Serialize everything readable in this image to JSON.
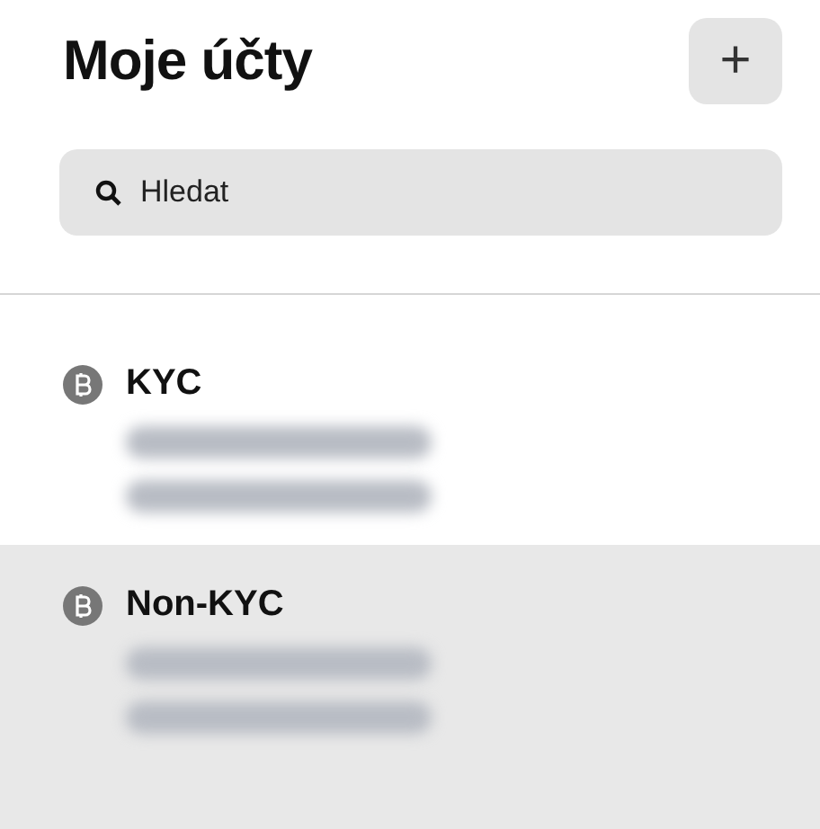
{
  "header": {
    "title": "Moje účty",
    "add_button": "+"
  },
  "search": {
    "placeholder": "Hledat"
  },
  "accounts": [
    {
      "name": "KYC",
      "selected": false,
      "details": [
        {
          "kind": "redacted"
        },
        {
          "kind": "redacted"
        }
      ]
    },
    {
      "name": "Non-KYC",
      "selected": true,
      "details": [
        {
          "kind": "redacted"
        },
        {
          "kind": "redacted"
        }
      ]
    }
  ]
}
